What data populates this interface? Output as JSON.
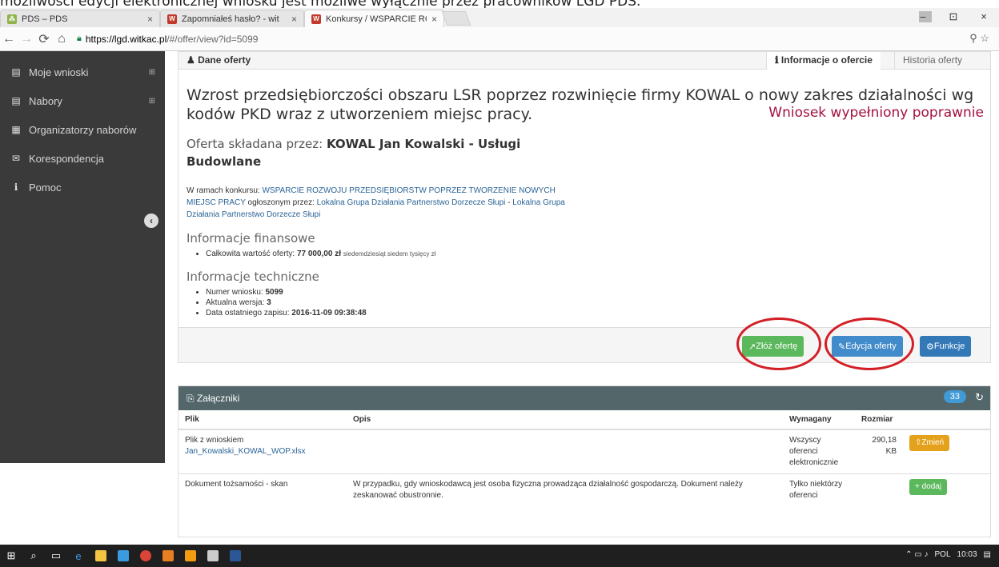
{
  "caption": "możliwości edycji elektronicznej wniosku jest możliwe wyłącznie przez pracowników LGD PDS.",
  "browser": {
    "tabs": [
      {
        "title": "PDS – PDS",
        "close": "×"
      },
      {
        "title": "Zapomniałeś hasło? - wit",
        "close": "×"
      },
      {
        "title": "Konkursy / WSPARCIE RC",
        "close": "×"
      }
    ],
    "url_host": "https://lgd.witkac.pl",
    "url_path": "/#/offer/view?id=5099",
    "window_controls": [
      "–",
      "⊡",
      "×"
    ]
  },
  "sidebar": {
    "items": [
      {
        "label": "Moje wnioski",
        "icon": "book-icon",
        "expandable": true
      },
      {
        "label": "Nabory",
        "icon": "book-icon",
        "expandable": true
      },
      {
        "label": "Organizatorzy naborów",
        "icon": "building-icon",
        "expandable": false
      },
      {
        "label": "Korespondencja",
        "icon": "envelope-icon",
        "expandable": false
      },
      {
        "label": "Pomoc",
        "icon": "info-icon",
        "expandable": false
      }
    ]
  },
  "panel": {
    "header_label": "Dane oferty",
    "tab_info": "Informacje o ofercie",
    "tab_history": "Historia oferty",
    "title": "Wzrost przedsiębiorczości obszaru LSR poprzez rozwinięcie firmy KOWAL o nowy zakres działalności wg kodów PKD wraz z utworzeniem miejsc pracy.",
    "status": "Wniosek wypełniony poprawnie",
    "submitted_by_prefix": "Oferta składana przez:",
    "submitted_by_name": "KOWAL Jan Kowalski - Usługi Budowlane",
    "konkurs_prefix": "W ramach konkursu:",
    "konkurs_name": "WSPARCIE ROZWOJU PRZEDSIĘBIORSTW POPRZEZ TWORZENIE NOWYCH MIEJSC PRACY",
    "announced_by": "ogłoszonym przez:",
    "organizer": "Lokalna Grupa Działania Partnerstwo Dorzecze Słupi",
    "organizer_dash": "-",
    "organizer2": "Lokalna Grupa Działania Partnerstwo Dorzecze Słupi",
    "fin_title": "Informacje finansowe",
    "fin_label": "Całkowita wartość oferty:",
    "fin_value": "77 000,00 zł",
    "fin_words": "siedemdziesiąt siedem tysięcy zł",
    "tech_title": "Informacje techniczne",
    "tech_num_label": "Numer wniosku:",
    "tech_num_value": "5099",
    "tech_ver_label": "Aktualna wersja:",
    "tech_ver_value": "3",
    "tech_date_label": "Data ostatniego zapisu:",
    "tech_date_value": "2016-11-09 09:38:48",
    "btn_submit": "Złóż ofertę",
    "btn_edit": "Edycja oferty",
    "btn_functions": "Funkcje"
  },
  "attachments": {
    "header": "Załączniki",
    "count": "33",
    "columns": [
      "Plik",
      "Opis",
      "Wymagany",
      "Rozmiar",
      ""
    ],
    "rows": [
      {
        "file": "Plik z wnioskiem",
        "link": "Jan_Kowalski_KOWAL_WOP.xlsx",
        "desc": "",
        "required": "Wszyscy oferenci elektronicznie",
        "size": "290,18 KB",
        "action": "Zmień"
      },
      {
        "file": "Dokument tożsamości - skan",
        "link": "",
        "desc": "W przypadku, gdy wnioskodawcą jest osoba fizyczna prowadząca działalność gospodarczą. Dokument należy zeskanować obustronnie.",
        "required": "Tylko niektórzy oferenci",
        "size": "",
        "action": "dodaj"
      }
    ]
  },
  "taskbar": {
    "tray_lang": "POL",
    "tray_time": "10:03"
  },
  "colors": {
    "status_red": "#a4123f",
    "annotation_red": "#d31f26",
    "sidebar_bg": "#3a3a3a",
    "att_header": "#53676b"
  }
}
